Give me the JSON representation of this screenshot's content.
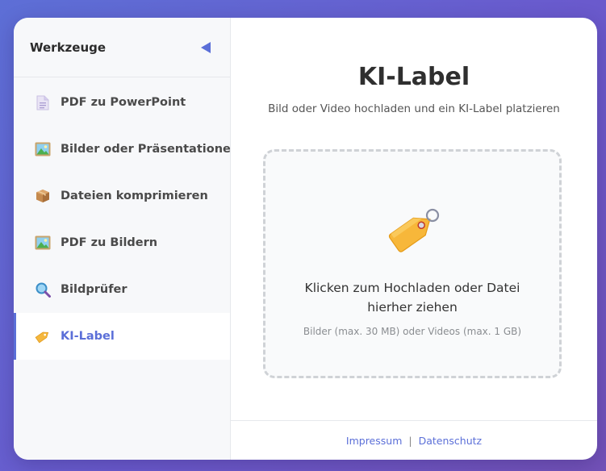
{
  "sidebar": {
    "title": "Werkzeuge",
    "collapse_icon": "triangle-left-icon",
    "accent": "#5b6fd8",
    "items": [
      {
        "label": "PDF zu PowerPoint",
        "icon": "document-icon",
        "active": false
      },
      {
        "label": "Bilder oder Präsentationen zu PDF",
        "icon": "picture-icon",
        "active": false
      },
      {
        "label": "Dateien komprimieren",
        "icon": "package-icon",
        "active": false
      },
      {
        "label": "PDF zu Bildern",
        "icon": "picture-icon",
        "active": false
      },
      {
        "label": "Bildprüfer",
        "icon": "magnifier-icon",
        "active": false
      },
      {
        "label": "KI-Label",
        "icon": "tag-icon",
        "active": true
      }
    ]
  },
  "main": {
    "title": "KI-Label",
    "subtitle": "Bild oder Video hochladen und ein KI-Label platzieren",
    "dropzone": {
      "icon": "tag-icon",
      "main_text": "Klicken zum Hochladen oder Datei hierher ziehen",
      "hint": "Bilder (max. 30 MB) oder Videos (max. 1 GB)"
    }
  },
  "footer": {
    "impressum": "Impressum",
    "separator": "|",
    "datenschutz": "Datenschutz"
  }
}
